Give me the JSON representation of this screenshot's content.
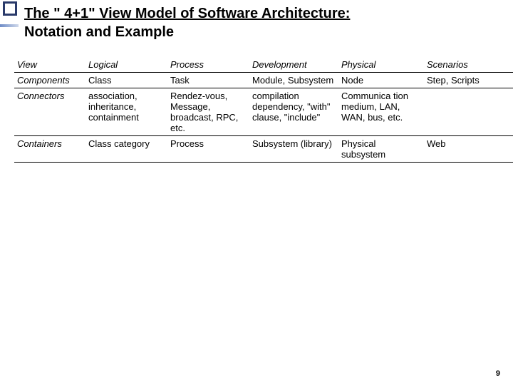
{
  "title": {
    "line1": "The \" 4+1\" View Model of Software Architecture:",
    "line2": "Notation and Example"
  },
  "table": {
    "headers": [
      "View",
      "Logical",
      "Process",
      "Development",
      "Physical",
      "Scenarios"
    ],
    "rows": [
      {
        "label": "Components",
        "cells": [
          "Class",
          "Task",
          "Module, Subsystem",
          "Node",
          "Step, Scripts"
        ]
      },
      {
        "label": "Connectors",
        "cells": [
          "association, inheritance, containment",
          "Rendez-vous, Message, broadcast, RPC, etc.",
          "compilation dependency, \"with\" clause, \"include\"",
          "Communica tion medium, LAN, WAN, bus, etc.",
          ""
        ]
      },
      {
        "label": "Containers",
        "cells": [
          "Class category",
          "Process",
          "Subsystem (library)",
          "Physical subsystem",
          "Web"
        ]
      }
    ]
  },
  "page_number": "9",
  "chart_data": {
    "type": "table",
    "title": "The \"4+1\" View Model of Software Architecture: Notation and Example",
    "columns": [
      "View",
      "Logical",
      "Process",
      "Development",
      "Physical",
      "Scenarios"
    ],
    "rows": [
      [
        "Components",
        "Class",
        "Task",
        "Module, Subsystem",
        "Node",
        "Step, Scripts"
      ],
      [
        "Connectors",
        "association, inheritance, containment",
        "Rendez-vous, Message, broadcast, RPC, etc.",
        "compilation dependency, \"with\" clause, \"include\"",
        "Communication medium, LAN, WAN, bus, etc.",
        ""
      ],
      [
        "Containers",
        "Class category",
        "Process",
        "Subsystem (library)",
        "Physical subsystem",
        "Web"
      ]
    ]
  }
}
